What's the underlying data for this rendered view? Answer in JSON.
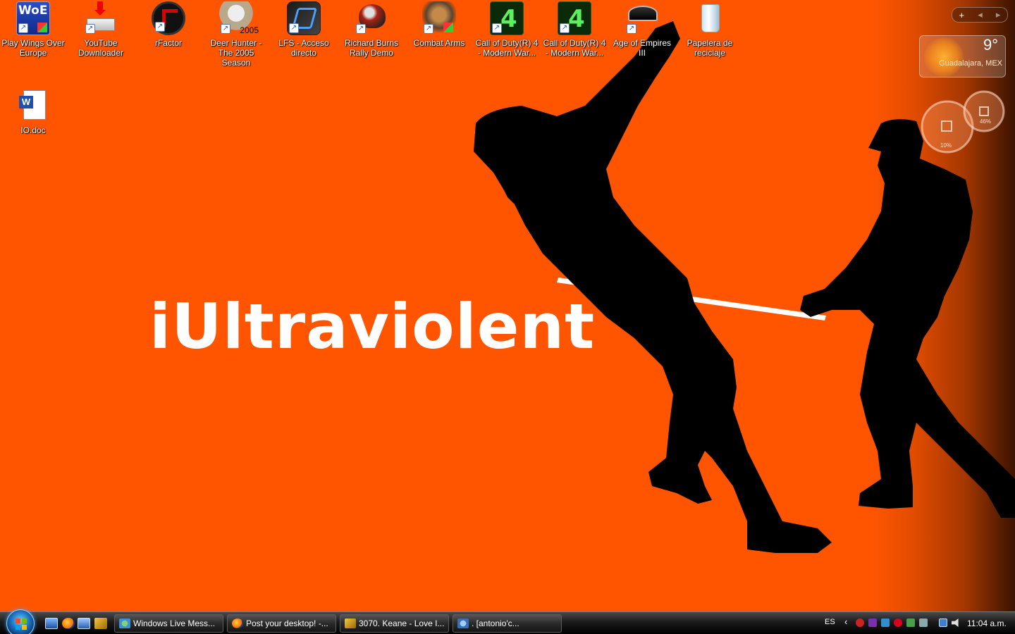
{
  "desktop": {
    "hero_text": "iUltraviolent",
    "icons": [
      {
        "label": "Play Wings Over Europe",
        "icon": "woe-icon"
      },
      {
        "label": "YouTube Downloader",
        "icon": "youtube-downloader-icon"
      },
      {
        "label": "rFactor",
        "icon": "rfactor-icon"
      },
      {
        "label": "Deer Hunter - The 2005 Season",
        "icon": "deer-hunter-icon",
        "badge": "2005"
      },
      {
        "label": "LFS - Acceso directo",
        "icon": "lfs-icon"
      },
      {
        "label": "Richard Burns Rally Demo",
        "icon": "helmet-icon"
      },
      {
        "label": "Combat Arms",
        "icon": "combat-arms-icon"
      },
      {
        "label": "Call of Duty(R) 4 - Modern War...",
        "icon": "cod4-icon"
      },
      {
        "label": "Call of Duty(R) 4 - Modern War...",
        "icon": "cod4-icon"
      },
      {
        "label": "Age of Empires III",
        "icon": "aoe3-icon"
      },
      {
        "label": "Papelera de reciclaje",
        "icon": "recycle-bin-icon"
      },
      {
        "label": "IO.doc",
        "icon": "word-doc-icon"
      }
    ],
    "woe_logo_text": "WoE"
  },
  "gadgets": {
    "toolbar": {
      "add": "+",
      "prev": "◂",
      "next": "▸"
    },
    "weather": {
      "temp": "9°",
      "city": "Guadalajara, MEX"
    },
    "meter": {
      "cpu_percent": "10%",
      "ram_percent": "46%"
    }
  },
  "taskbar": {
    "tasks": [
      {
        "label": "Windows Live Mess...",
        "icon": "messenger-icon"
      },
      {
        "label": "Post your desktop! -...",
        "icon": "firefox-icon"
      },
      {
        "label": "3070. Keane - Love I...",
        "icon": "winamp-icon"
      },
      {
        "label": ".          [antonio'c...",
        "icon": "messenger-chat-icon"
      }
    ],
    "tray": {
      "language": "ES",
      "chevron": "‹",
      "clock": "11:04 a.m."
    }
  },
  "colors": {
    "wallpaper": "#ff5500",
    "hero_text": "#ffffff"
  }
}
